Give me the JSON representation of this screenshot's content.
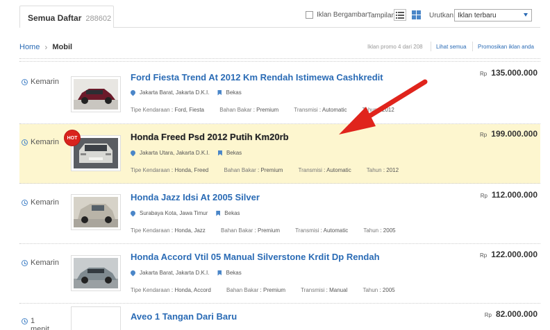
{
  "tab": {
    "label": "Semua Daftar",
    "count": "288602"
  },
  "filters": {
    "with_images_label": "Iklan Bergambar",
    "view_label": "Tampilan:",
    "sort_label": "Urutkan:",
    "sort_value": "Iklan terbaru"
  },
  "breadcrumb": {
    "home": "Home",
    "current": "Mobil"
  },
  "promo": {
    "info": "Iklan promo 4 dari 208",
    "see_all": "Lihat semua",
    "promote": "Promosikan iklan anda"
  },
  "spec_labels": {
    "type": "Tipe Kendaraan",
    "fuel": "Bahan Bakar",
    "transmission": "Transmisi",
    "year": "Tahun"
  },
  "currency": "Rp",
  "listings": [
    {
      "time": "Kemarin",
      "title": "Ford Fiesta Trend At 2012 Km Rendah Istimewa Cashkredit",
      "location": "Jakarta Barat, Jakarta D.K.I.",
      "condition": "Bekas",
      "type": ": Ford, Fiesta",
      "fuel": ": Premium",
      "transmission": ": Automatic",
      "year": ": 2012",
      "price": "135.000.000",
      "hot": false,
      "car_color": "#6b1a2a"
    },
    {
      "time": "Kemarin",
      "title": "Honda Freed Psd 2012 Putih Km20rb",
      "location": "Jakarta Utara, Jakarta D.K.I.",
      "condition": "Bekas",
      "type": ": Honda, Freed",
      "fuel": ": Premium",
      "transmission": ": Automatic",
      "year": ": 2012",
      "price": "199.000.000",
      "hot": true,
      "hot_label": "HOT",
      "car_color": "#d8d8d4"
    },
    {
      "time": "Kemarin",
      "title": "Honda Jazz Idsi At 2005 Silver",
      "location": "Surabaya Kota, Jawa Timur",
      "condition": "Bekas",
      "type": ": Honda, Jazz",
      "fuel": ": Premium",
      "transmission": ": Automatic",
      "year": ": 2005",
      "price": "112.000.000",
      "hot": false,
      "car_color": "#b9b4a8"
    },
    {
      "time": "Kemarin",
      "title": "Honda Accord Vtil 05 Manual Silverstone Krdit Dp Rendah",
      "location": "Jakarta Barat, Jakarta D.K.I.",
      "condition": "Bekas",
      "type": ": Honda, Accord",
      "fuel": ": Premium",
      "transmission": ": Manual",
      "year": ": 2005",
      "price": "122.000.000",
      "hot": false,
      "car_color": "#7f8a90"
    },
    {
      "time": "1 menit lalu",
      "title": "Aveo 1 Tangan Dari Baru",
      "price": "82.000.000",
      "hot": false
    }
  ],
  "colors": {
    "link": "#2a6bb5",
    "hot_bg": "#fdf6cf",
    "hot_badge": "#d9231d",
    "arrow": "#e0241c"
  }
}
